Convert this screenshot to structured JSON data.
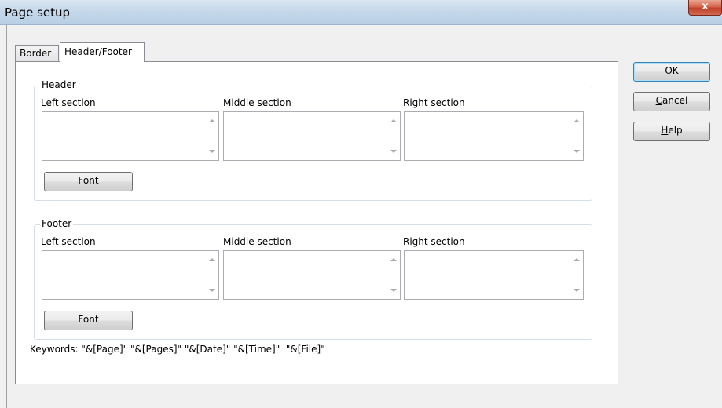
{
  "window": {
    "title": "Page setup",
    "close_glyph": "x"
  },
  "tabs": [
    {
      "label": "Border",
      "active": false
    },
    {
      "label": "Header/Footer",
      "active": true
    }
  ],
  "header": {
    "group_label": "Header",
    "left_label": "Left section",
    "middle_label": "Middle section",
    "right_label": "Right section",
    "font_button": "Font"
  },
  "footer": {
    "group_label": "Footer",
    "left_label": "Left section",
    "middle_label": "Middle section",
    "right_label": "Right section",
    "font_button": "Font"
  },
  "keywords_text": "Keywords: \"&[Page]\" \"&[Pages]\" \"&[Date]\" \"&[Time]\"  \"&[File]\"",
  "buttons": {
    "ok": {
      "mnemonic": "O",
      "rest": "K"
    },
    "cancel": {
      "mnemonic": "C",
      "rest": "ancel"
    },
    "help": {
      "mnemonic": "H",
      "rest": "elp"
    }
  }
}
